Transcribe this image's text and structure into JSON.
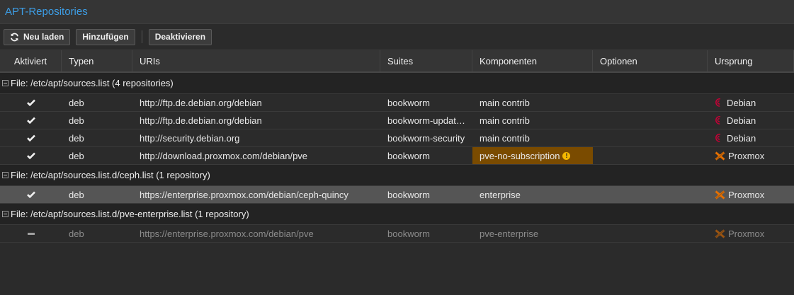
{
  "title": "APT-Repositories",
  "toolbar": {
    "reload_label": "Neu laden",
    "add_label": "Hinzufügen",
    "deactivate_label": "Deaktivieren"
  },
  "columns": [
    "Aktiviert",
    "Typen",
    "URIs",
    "Suites",
    "Komponenten",
    "Optionen",
    "Ursprung"
  ],
  "groups": [
    {
      "label": "File: /etc/apt/sources.list (4 repositories)",
      "rows": [
        {
          "enabled": true,
          "type": "deb",
          "uri": "http://ftp.de.debian.org/debian",
          "suite": "bookworm",
          "components": "main contrib",
          "options": "",
          "origin": "Debian"
        },
        {
          "enabled": true,
          "type": "deb",
          "uri": "http://ftp.de.debian.org/debian",
          "suite": "bookworm-updat…",
          "components": "main contrib",
          "options": "",
          "origin": "Debian"
        },
        {
          "enabled": true,
          "type": "deb",
          "uri": "http://security.debian.org",
          "suite": "bookworm-security",
          "components": "main contrib",
          "options": "",
          "origin": "Debian"
        },
        {
          "enabled": true,
          "type": "deb",
          "uri": "http://download.proxmox.com/debian/pve",
          "suite": "bookworm",
          "components": "pve-no-subscription",
          "options": "",
          "origin": "Proxmox"
        }
      ]
    },
    {
      "label": "File: /etc/apt/sources.list.d/ceph.list (1 repository)",
      "rows": [
        {
          "enabled": true,
          "type": "deb",
          "uri": "https://enterprise.proxmox.com/debian/ceph-quincy",
          "suite": "bookworm",
          "components": "enterprise",
          "options": "",
          "origin": "Proxmox"
        }
      ]
    },
    {
      "label": "File: /etc/apt/sources.list.d/pve-enterprise.list (1 repository)",
      "rows": [
        {
          "enabled": false,
          "type": "deb",
          "uri": "https://enterprise.proxmox.com/debian/pve",
          "suite": "bookworm",
          "components": "pve-enterprise",
          "options": "",
          "origin": "Proxmox"
        }
      ]
    }
  ],
  "colors": {
    "accent": "#3d9ee6",
    "warning_bg": "#7a4b00",
    "warning_icon": "#f5b800",
    "selected_row": "#555555",
    "debian_red": "#c70036",
    "proxmox_orange": "#e57000"
  },
  "icons": {
    "reload": "refresh-icon",
    "enabled": "check-icon",
    "disabled": "dash-icon",
    "warning": "exclamation-circle-icon",
    "debian": "debian-swirl-icon",
    "proxmox": "proxmox-x-icon"
  }
}
